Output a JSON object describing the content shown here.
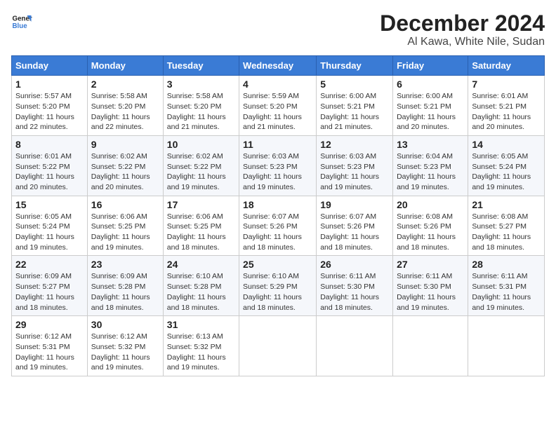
{
  "logo": {
    "line1": "General",
    "line2": "Blue"
  },
  "title": "December 2024",
  "location": "Al Kawa, White Nile, Sudan",
  "weekdays": [
    "Sunday",
    "Monday",
    "Tuesday",
    "Wednesday",
    "Thursday",
    "Friday",
    "Saturday"
  ],
  "weeks": [
    [
      {
        "day": "1",
        "info": "Sunrise: 5:57 AM\nSunset: 5:20 PM\nDaylight: 11 hours\nand 22 minutes."
      },
      {
        "day": "2",
        "info": "Sunrise: 5:58 AM\nSunset: 5:20 PM\nDaylight: 11 hours\nand 22 minutes."
      },
      {
        "day": "3",
        "info": "Sunrise: 5:58 AM\nSunset: 5:20 PM\nDaylight: 11 hours\nand 21 minutes."
      },
      {
        "day": "4",
        "info": "Sunrise: 5:59 AM\nSunset: 5:20 PM\nDaylight: 11 hours\nand 21 minutes."
      },
      {
        "day": "5",
        "info": "Sunrise: 6:00 AM\nSunset: 5:21 PM\nDaylight: 11 hours\nand 21 minutes."
      },
      {
        "day": "6",
        "info": "Sunrise: 6:00 AM\nSunset: 5:21 PM\nDaylight: 11 hours\nand 20 minutes."
      },
      {
        "day": "7",
        "info": "Sunrise: 6:01 AM\nSunset: 5:21 PM\nDaylight: 11 hours\nand 20 minutes."
      }
    ],
    [
      {
        "day": "8",
        "info": "Sunrise: 6:01 AM\nSunset: 5:22 PM\nDaylight: 11 hours\nand 20 minutes."
      },
      {
        "day": "9",
        "info": "Sunrise: 6:02 AM\nSunset: 5:22 PM\nDaylight: 11 hours\nand 20 minutes."
      },
      {
        "day": "10",
        "info": "Sunrise: 6:02 AM\nSunset: 5:22 PM\nDaylight: 11 hours\nand 19 minutes."
      },
      {
        "day": "11",
        "info": "Sunrise: 6:03 AM\nSunset: 5:23 PM\nDaylight: 11 hours\nand 19 minutes."
      },
      {
        "day": "12",
        "info": "Sunrise: 6:03 AM\nSunset: 5:23 PM\nDaylight: 11 hours\nand 19 minutes."
      },
      {
        "day": "13",
        "info": "Sunrise: 6:04 AM\nSunset: 5:23 PM\nDaylight: 11 hours\nand 19 minutes."
      },
      {
        "day": "14",
        "info": "Sunrise: 6:05 AM\nSunset: 5:24 PM\nDaylight: 11 hours\nand 19 minutes."
      }
    ],
    [
      {
        "day": "15",
        "info": "Sunrise: 6:05 AM\nSunset: 5:24 PM\nDaylight: 11 hours\nand 19 minutes."
      },
      {
        "day": "16",
        "info": "Sunrise: 6:06 AM\nSunset: 5:25 PM\nDaylight: 11 hours\nand 19 minutes."
      },
      {
        "day": "17",
        "info": "Sunrise: 6:06 AM\nSunset: 5:25 PM\nDaylight: 11 hours\nand 18 minutes."
      },
      {
        "day": "18",
        "info": "Sunrise: 6:07 AM\nSunset: 5:26 PM\nDaylight: 11 hours\nand 18 minutes."
      },
      {
        "day": "19",
        "info": "Sunrise: 6:07 AM\nSunset: 5:26 PM\nDaylight: 11 hours\nand 18 minutes."
      },
      {
        "day": "20",
        "info": "Sunrise: 6:08 AM\nSunset: 5:26 PM\nDaylight: 11 hours\nand 18 minutes."
      },
      {
        "day": "21",
        "info": "Sunrise: 6:08 AM\nSunset: 5:27 PM\nDaylight: 11 hours\nand 18 minutes."
      }
    ],
    [
      {
        "day": "22",
        "info": "Sunrise: 6:09 AM\nSunset: 5:27 PM\nDaylight: 11 hours\nand 18 minutes."
      },
      {
        "day": "23",
        "info": "Sunrise: 6:09 AM\nSunset: 5:28 PM\nDaylight: 11 hours\nand 18 minutes."
      },
      {
        "day": "24",
        "info": "Sunrise: 6:10 AM\nSunset: 5:28 PM\nDaylight: 11 hours\nand 18 minutes."
      },
      {
        "day": "25",
        "info": "Sunrise: 6:10 AM\nSunset: 5:29 PM\nDaylight: 11 hours\nand 18 minutes."
      },
      {
        "day": "26",
        "info": "Sunrise: 6:11 AM\nSunset: 5:30 PM\nDaylight: 11 hours\nand 18 minutes."
      },
      {
        "day": "27",
        "info": "Sunrise: 6:11 AM\nSunset: 5:30 PM\nDaylight: 11 hours\nand 19 minutes."
      },
      {
        "day": "28",
        "info": "Sunrise: 6:11 AM\nSunset: 5:31 PM\nDaylight: 11 hours\nand 19 minutes."
      }
    ],
    [
      {
        "day": "29",
        "info": "Sunrise: 6:12 AM\nSunset: 5:31 PM\nDaylight: 11 hours\nand 19 minutes."
      },
      {
        "day": "30",
        "info": "Sunrise: 6:12 AM\nSunset: 5:32 PM\nDaylight: 11 hours\nand 19 minutes."
      },
      {
        "day": "31",
        "info": "Sunrise: 6:13 AM\nSunset: 5:32 PM\nDaylight: 11 hours\nand 19 minutes."
      },
      {
        "day": "",
        "info": ""
      },
      {
        "day": "",
        "info": ""
      },
      {
        "day": "",
        "info": ""
      },
      {
        "day": "",
        "info": ""
      }
    ]
  ]
}
